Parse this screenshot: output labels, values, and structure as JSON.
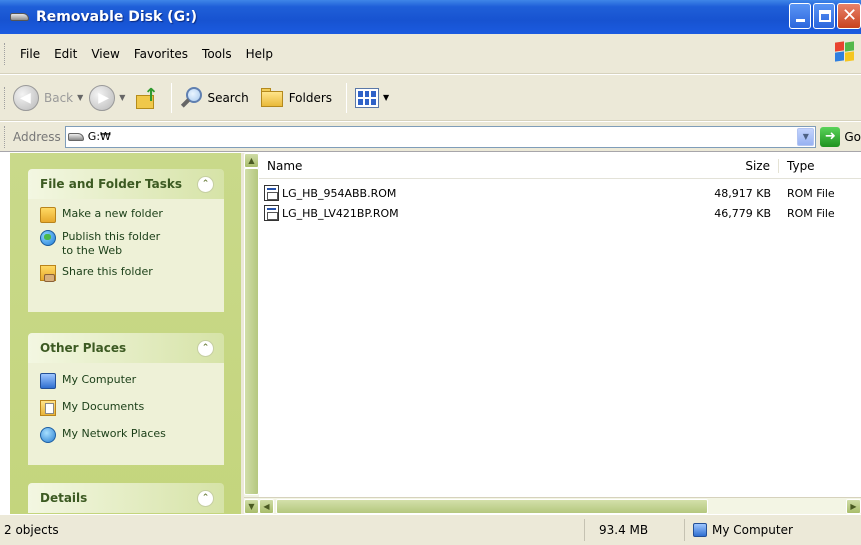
{
  "window": {
    "title": "Removable Disk (G:)"
  },
  "menu": [
    "File",
    "Edit",
    "View",
    "Favorites",
    "Tools",
    "Help"
  ],
  "toolbar": {
    "back": "Back",
    "search": "Search",
    "folders": "Folders"
  },
  "address": {
    "label": "Address",
    "value": "G:₩",
    "go": "Go"
  },
  "tasks": {
    "file_folder": {
      "title": "File and Folder Tasks",
      "items": [
        "Make a new folder",
        "Publish this folder to the Web",
        "Share this folder"
      ]
    },
    "other_places": {
      "title": "Other Places",
      "items": [
        "My Computer",
        "My Documents",
        "My Network Places"
      ]
    },
    "details": {
      "title": "Details"
    }
  },
  "list": {
    "columns": {
      "name": "Name",
      "size": "Size",
      "type": "Type"
    },
    "files": [
      {
        "name": "LG_HB_954ABB.ROM",
        "size": "48,917 KB",
        "type": "ROM File"
      },
      {
        "name": "LG_HB_LV421BP.ROM",
        "size": "46,779 KB",
        "type": "ROM File"
      }
    ]
  },
  "status": {
    "objects": "2 objects",
    "size": "93.4 MB",
    "zone": "My Computer"
  },
  "colors": {
    "title_bar": "#1753d1",
    "task_pane": "#c4d57d",
    "chrome": "#ece9d8"
  }
}
